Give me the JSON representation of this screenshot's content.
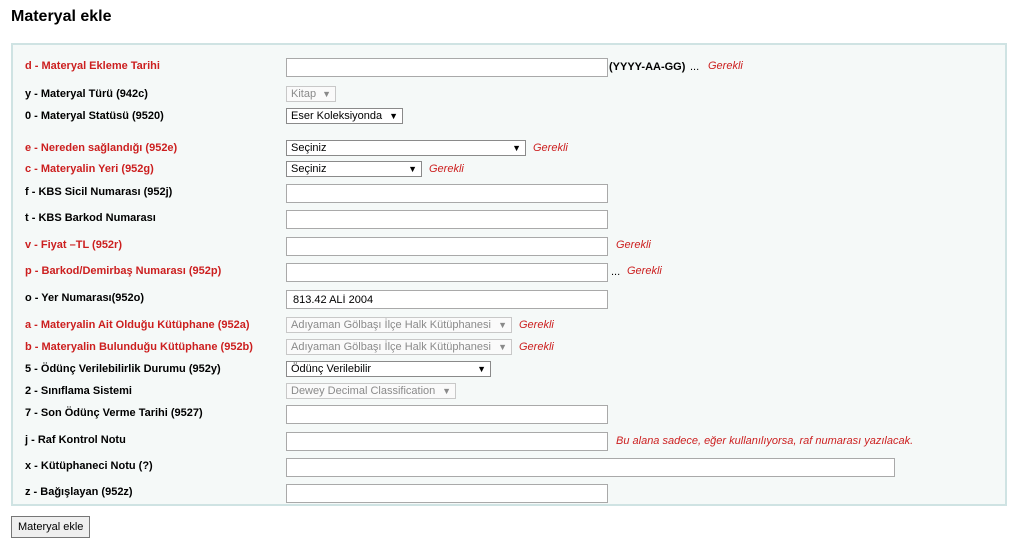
{
  "page_title": "Materyal ekle",
  "fields": {
    "ekleme_tarihi": {
      "label": "d - Materyal Ekleme Tarihi",
      "value": "",
      "hint": "(YYYY-AA-GG)",
      "ellipsis": "...",
      "required": "Gerekli"
    },
    "materyal_turu": {
      "label": "y - Materyal Türü (942c)",
      "selected": "Kitap"
    },
    "materyal_statusu": {
      "label": "0 - Materyal Statüsü (9520)",
      "selected": "Eser Koleksiyonda"
    },
    "nereden": {
      "label": "e - Nereden sağlandığı (952e)",
      "selected": "Seçiniz",
      "required": "Gerekli"
    },
    "materyal_yeri": {
      "label": "c - Materyalin Yeri (952g)",
      "selected": "Seçiniz",
      "required": "Gerekli"
    },
    "sicil": {
      "label": "f - KBS Sicil Numarası (952j)",
      "value": ""
    },
    "barkod": {
      "label": "t - KBS Barkod Numarası",
      "value": ""
    },
    "fiyat": {
      "label": "v - Fiyat –TL (952r)",
      "value": "",
      "required": "Gerekli"
    },
    "demirbas": {
      "label": "p - Barkod/Demirbaş Numarası (952p)",
      "value": "",
      "ellipsis": "...",
      "required": "Gerekli"
    },
    "yer_numarasi": {
      "label": "o - Yer Numarası(952o)",
      "value": "813.42 ALİ 2004"
    },
    "ait_kutuphane": {
      "label": "a - Materyalin Ait Olduğu Kütüphane (952a)",
      "selected": "Adıyaman Gölbaşı İlçe Halk Kütüphanesi",
      "required": "Gerekli"
    },
    "bulundugu_kutuphane": {
      "label": "b - Materyalin Bulunduğu Kütüphane (952b)",
      "selected": "Adıyaman Gölbaşı İlçe Halk Kütüphanesi",
      "required": "Gerekli"
    },
    "odunc_durumu": {
      "label": "5 - Ödünç Verilebilirlik Durumu (952y)",
      "selected": "Ödünç Verilebilir"
    },
    "siniflama": {
      "label": "2 - Sınıflama Sistemi",
      "selected": "Dewey Decimal Classification"
    },
    "son_odunc": {
      "label": "7 - Son Ödünç Verme Tarihi (9527)",
      "value": ""
    },
    "raf_notu": {
      "label": "j - Raf Kontrol Notu",
      "value": "",
      "note": "Bu alana sadece, eğer kullanılıyorsa, raf numarası yazılacak."
    },
    "kutuphaneci_notu": {
      "label": "x - Kütüphaneci Notu (?)",
      "value": ""
    },
    "bagislayan": {
      "label": "z - Bağışlayan (952z)",
      "value": ""
    }
  },
  "submit_label": "Materyal ekle",
  "colors": {
    "required": "#cc1f1f",
    "panel_border": "#cfe3e3",
    "panel_bg": "#f5f9f8"
  }
}
